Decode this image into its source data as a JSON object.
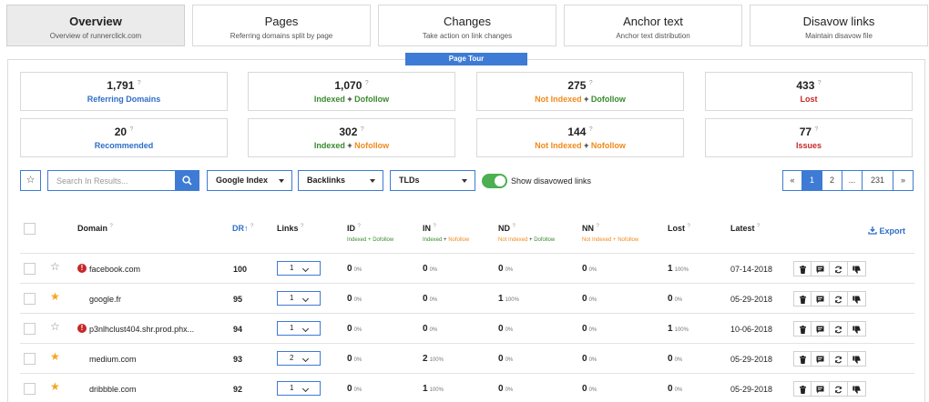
{
  "tabs": [
    {
      "title": "Overview",
      "subtitle": "Overview of runnerclick.com"
    },
    {
      "title": "Pages",
      "subtitle": "Referring domains split by page"
    },
    {
      "title": "Changes",
      "subtitle": "Take action on link changes"
    },
    {
      "title": "Anchor text",
      "subtitle": "Anchor text distribution"
    },
    {
      "title": "Disavow links",
      "subtitle": "Maintain disavow file"
    }
  ],
  "page_tour": "Page Tour",
  "stats": [
    {
      "value": "1,791",
      "label": "Referring Domains"
    },
    {
      "value": "1,070",
      "label_a": "Indexed",
      "plus": "+",
      "label_b": "Dofollow"
    },
    {
      "value": "275",
      "label_a": "Not Indexed",
      "plus": "+",
      "label_b": "Dofollow"
    },
    {
      "value": "433",
      "label": "Lost"
    },
    {
      "value": "20",
      "label": "Recommended"
    },
    {
      "value": "302",
      "label_a": "Indexed",
      "plus": "+",
      "label_b": "Nofollow"
    },
    {
      "value": "144",
      "label_a": "Not Indexed",
      "plus": "+",
      "label_b": "Nofollow"
    },
    {
      "value": "77",
      "label": "Issues"
    }
  ],
  "info_mark": "?",
  "toolbar": {
    "star": "☆",
    "search_placeholder": "Search In Results...",
    "dropdowns": [
      "Google Index",
      "Backlinks",
      "TLDs"
    ],
    "toggle_label": "Show disavowed links"
  },
  "pagination": [
    "«",
    "1",
    "2",
    "...",
    "231",
    "»"
  ],
  "columns": {
    "domain": "Domain",
    "dr": "DR",
    "dr_arrow": "↑",
    "links": "Links",
    "id": "ID",
    "id_sub": "Indexed + Dofollow",
    "in": "IN",
    "in_sub_a": "Indexed",
    "in_sub_plus": "+",
    "in_sub_b": "Nofollow",
    "nd": "ND",
    "nd_sub_a": "Not Indexed",
    "nd_sub_plus": "+",
    "nd_sub_b": "Dofollow",
    "nn": "NN",
    "nn_sub": "Not Indexed + Nofollow",
    "lost": "Lost",
    "latest": "Latest",
    "export": "Export"
  },
  "rows": [
    {
      "domain": "facebook.com",
      "fav": "☆",
      "error": "!",
      "dr": "100",
      "links": "1",
      "id": "0",
      "id_pct": "0%",
      "in": "0",
      "in_pct": "0%",
      "nd": "0",
      "nd_pct": "0%",
      "nn": "0",
      "nn_pct": "0%",
      "lost": "1",
      "lost_pct": "100%",
      "latest": "07-14-2018"
    },
    {
      "domain": "google.fr",
      "fav": "★",
      "error": "",
      "dr": "95",
      "links": "1",
      "id": "0",
      "id_pct": "0%",
      "in": "0",
      "in_pct": "0%",
      "nd": "1",
      "nd_pct": "100%",
      "nn": "0",
      "nn_pct": "0%",
      "lost": "0",
      "lost_pct": "0%",
      "latest": "05-29-2018"
    },
    {
      "domain": "p3nlhclust404.shr.prod.phx...",
      "fav": "☆",
      "error": "!",
      "dr": "94",
      "links": "1",
      "id": "0",
      "id_pct": "0%",
      "in": "0",
      "in_pct": "0%",
      "nd": "0",
      "nd_pct": "0%",
      "nn": "0",
      "nn_pct": "0%",
      "lost": "1",
      "lost_pct": "100%",
      "latest": "10-06-2018"
    },
    {
      "domain": "medium.com",
      "fav": "★",
      "error": "",
      "dr": "93",
      "links": "2",
      "id": "0",
      "id_pct": "0%",
      "in": "2",
      "in_pct": "100%",
      "nd": "0",
      "nd_pct": "0%",
      "nn": "0",
      "nn_pct": "0%",
      "lost": "0",
      "lost_pct": "0%",
      "latest": "05-29-2018"
    },
    {
      "domain": "dribbble.com",
      "fav": "★",
      "error": "",
      "dr": "92",
      "links": "1",
      "id": "0",
      "id_pct": "0%",
      "in": "1",
      "in_pct": "100%",
      "nd": "0",
      "nd_pct": "0%",
      "nn": "0",
      "nn_pct": "0%",
      "lost": "0",
      "lost_pct": "0%",
      "latest": "05-29-2018"
    }
  ],
  "colors": {
    "accent": "#3e7bd4",
    "blue_label": "#2e6dc9",
    "green_label": "#3a8a2f",
    "orange_label": "#f08a1c",
    "red_label": "#c62828",
    "toggle_on": "#4caf50",
    "star_on": "#f5a623"
  },
  "icons": {
    "search": "search-icon",
    "export": "download-icon",
    "row_actions": [
      "trash-icon",
      "comment-icon",
      "refresh-icon",
      "thumbs-down-icon"
    ]
  }
}
